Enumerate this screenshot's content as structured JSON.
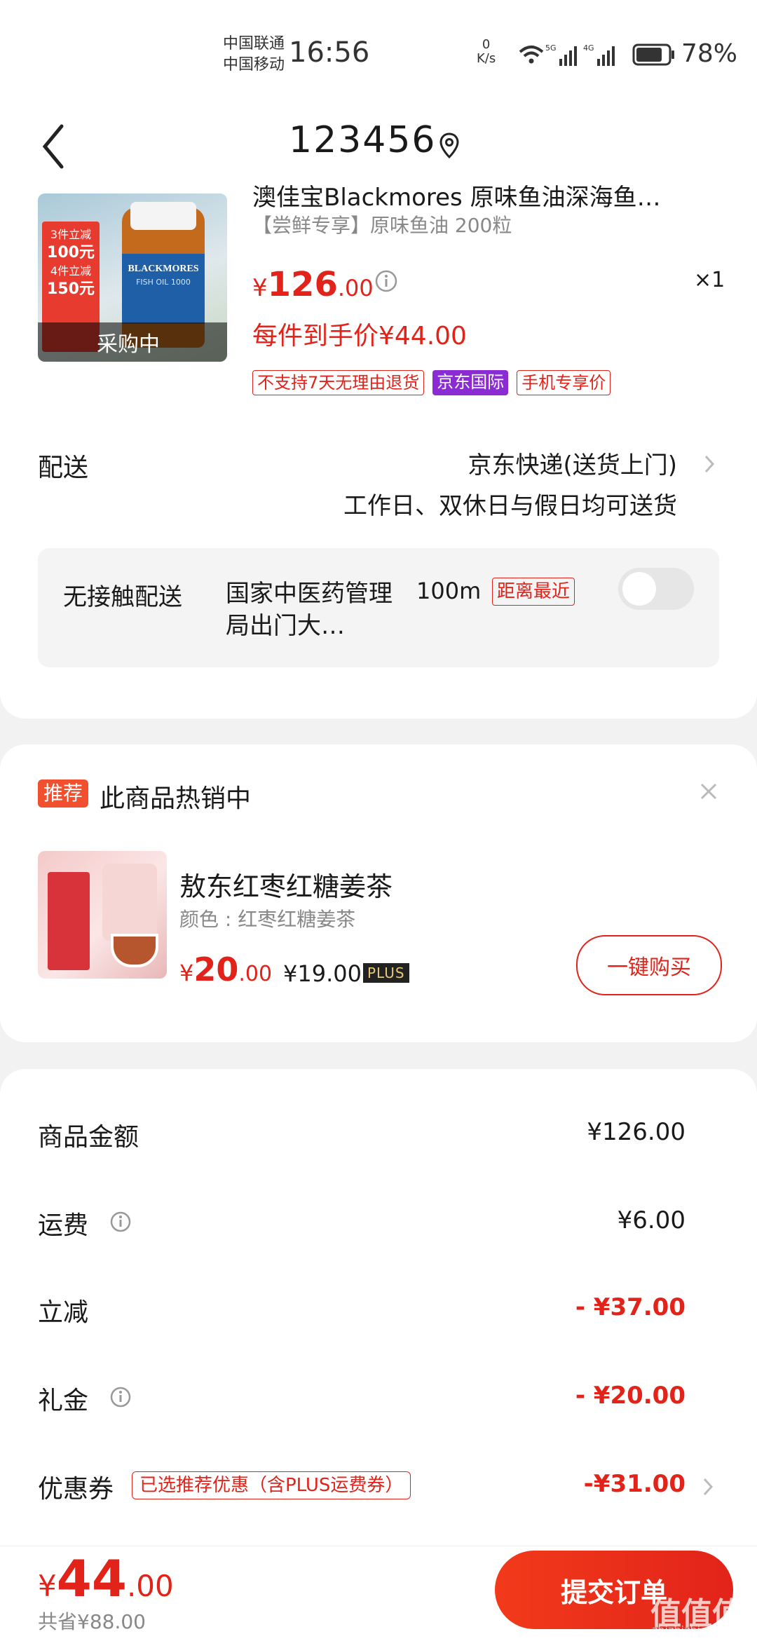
{
  "status_bar": {
    "carrier1": "中国联通",
    "carrier2": "中国移动",
    "time": "16:56",
    "net_speed_value": "0",
    "net_speed_unit": "K/s",
    "battery": "78%"
  },
  "nav": {
    "title": "123456"
  },
  "product": {
    "title": "澳佳宝Blackmores 原味鱼油深海鱼…",
    "spec": "【尝鲜专享】原味鱼油 200粒",
    "image_overlay": "采购中",
    "image_brand": "BLACKMORES",
    "image_sub": "FISH OIL 1000",
    "image_promo1": "3件立减",
    "image_promo1_val": "100元",
    "image_promo2": "4件立减",
    "image_promo2_val": "150元",
    "currency": "¥",
    "price_int": "126",
    "price_dec": ".00",
    "qty": "×1",
    "arrival": "每件到手价¥44.00",
    "tags": [
      "不支持7天无理由退货",
      "京东国际",
      "手机专享价"
    ]
  },
  "delivery": {
    "label": "配送",
    "method": "京东快递(送货上门)",
    "schedule": "工作日、双休日与假日均可送货",
    "contactless_label": "无接触配送",
    "contactless_place": "国家中医药管理局出门大…",
    "contactless_distance": "100m",
    "contactless_badge": "距离最近",
    "contactless_enabled": false
  },
  "recommend": {
    "badge": "推荐",
    "title": "此商品热销中",
    "name": "敖东红枣红糖姜茶",
    "spec": "颜色 : 红枣红糖姜茶",
    "currency": "¥",
    "price_int": "20",
    "price_dec": ".00",
    "plus_price": "¥19.00",
    "plus_label": "PLUS",
    "buy_label": "一键购买"
  },
  "summary": {
    "rows": [
      {
        "label": "商品金额",
        "value": "¥126.00"
      },
      {
        "label": "运费",
        "value": "¥6.00"
      },
      {
        "label": "立减",
        "value": "- ¥37.00"
      },
      {
        "label": "礼金",
        "value": "- ¥20.00"
      },
      {
        "label": "优惠券",
        "value": "-¥31.00"
      }
    ],
    "coupon_note": "已选推荐优惠（含PLUS运费券）"
  },
  "bottom": {
    "currency": "¥",
    "total_int": "44",
    "total_dec": ".00",
    "saved": "共省¥88.00",
    "submit": "提交订单"
  },
  "watermark": {
    "text": "值值值",
    "url": "zhizhizhi.com"
  },
  "colors": {
    "accent": "#e2231a",
    "purple_tag": "#8b2bd4",
    "recommend_badge": "#f0502e"
  }
}
